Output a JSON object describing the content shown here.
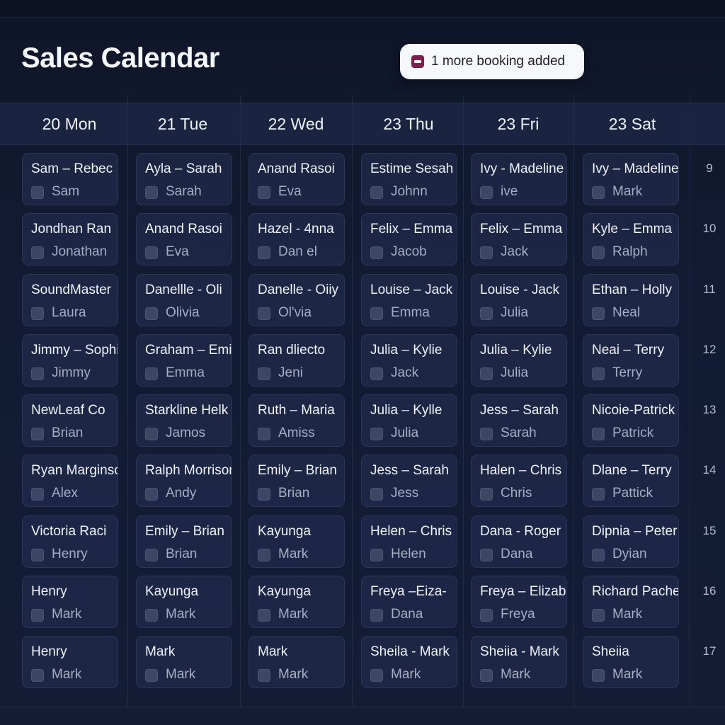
{
  "title": "Sales Calendar",
  "toast": {
    "icon": "calendar-minus-icon",
    "text": "1 more booking added"
  },
  "days": [
    {
      "label": "20 Mon",
      "bookings": [
        {
          "title": "Sam – Rebec",
          "person": "Sam"
        },
        {
          "title": "Jondhan Ran",
          "person": "Jonathan"
        },
        {
          "title": "SoundMaster",
          "person": "Laura"
        },
        {
          "title": "Jimmy – Sophi",
          "person": "Jimmy"
        },
        {
          "title": "NewLeaf Co",
          "person": "Brian"
        },
        {
          "title": "Ryan Marginso",
          "person": "Alex"
        },
        {
          "title": "Victoria Raci",
          "person": "Henry"
        },
        {
          "title": "Henry",
          "person": "Mark"
        },
        {
          "title": "Henry",
          "person": "Mark"
        }
      ]
    },
    {
      "label": "21 Tue",
      "bookings": [
        {
          "title": "Ayla – Sarah",
          "person": "Sarah"
        },
        {
          "title": "Anand Rasoi",
          "person": "Eva"
        },
        {
          "title": "Danellle - Oli",
          "person": "Olivia"
        },
        {
          "title": "Graham – Emi",
          "person": "Emma"
        },
        {
          "title": "Starkline Helk",
          "person": "Jamos"
        },
        {
          "title": "Ralph Morrisor",
          "person": "Andy"
        },
        {
          "title": "Emily – Brian",
          "person": "Brian"
        },
        {
          "title": "Kayunga",
          "person": "Mark"
        },
        {
          "title": "Mark",
          "person": "Mark"
        }
      ]
    },
    {
      "label": "22 Wed",
      "bookings": [
        {
          "title": "Anand Rasoi",
          "person": "Eva"
        },
        {
          "title": "Hazel - 4nna",
          "person": "Dan el"
        },
        {
          "title": "Danelle - Oiiy",
          "person": "Ol'via"
        },
        {
          "title": "Ran dliecto",
          "person": "Jeni"
        },
        {
          "title": "Ruth – Maria",
          "person": "Amiss"
        },
        {
          "title": "Emily – Brian",
          "person": "Brian"
        },
        {
          "title": "Kayunga",
          "person": "Mark"
        },
        {
          "title": "Kayunga",
          "person": "Mark"
        },
        {
          "title": "Mark",
          "person": "Mark"
        }
      ]
    },
    {
      "label": "23 Thu",
      "bookings": [
        {
          "title": "Estime Sesah",
          "person": "Johnn"
        },
        {
          "title": "Felix – Emma",
          "person": "Jacob"
        },
        {
          "title": "Louise – Jack",
          "person": "Emma"
        },
        {
          "title": "Julia – Kylie",
          "person": "Jack"
        },
        {
          "title": "Julia – Kylle",
          "person": "Julia"
        },
        {
          "title": "Jess – Sarah",
          "person": "Jess"
        },
        {
          "title": "Helen – Chris",
          "person": "Helen"
        },
        {
          "title": "Freya –Eiza-",
          "person": "Dana"
        },
        {
          "title": "Sheila - Mark",
          "person": "Mark"
        }
      ]
    },
    {
      "label": "23 Fri",
      "bookings": [
        {
          "title": "Ivy - Madeline",
          "person": "ive"
        },
        {
          "title": "Felix – Emma",
          "person": "Jack"
        },
        {
          "title": "Louise - Jack",
          "person": "Julia"
        },
        {
          "title": "Julia – Kylie",
          "person": "Julia"
        },
        {
          "title": "Jess – Sarah",
          "person": "Sarah"
        },
        {
          "title": "Halen – Chris",
          "person": "Chris"
        },
        {
          "title": "Dana - Roger",
          "person": "Dana"
        },
        {
          "title": "Freya – Elizabe",
          "person": "Freya"
        },
        {
          "title": "Sheiia - Mark",
          "person": "Mark"
        }
      ]
    },
    {
      "label": "23 Sat",
      "bookings": [
        {
          "title": "Ivy – Madeline",
          "person": "Mark"
        },
        {
          "title": "Kyle – Emma",
          "person": "Ralph"
        },
        {
          "title": "Ethan – Holly",
          "person": "Neal"
        },
        {
          "title": "Neai – Terry",
          "person": "Terry"
        },
        {
          "title": "Nicoie-Patrick",
          "person": "Patrick"
        },
        {
          "title": "Dlane – Terry",
          "person": "Pattick"
        },
        {
          "title": "Dipnia – Peter",
          "person": "Dyian"
        },
        {
          "title": "Richard Pachec",
          "person": "Mark"
        },
        {
          "title": "Sheiia",
          "person": "Mark"
        }
      ]
    }
  ],
  "hours": [
    "9",
    "10",
    "11",
    "12",
    "13",
    "14",
    "15",
    "16",
    "17"
  ]
}
